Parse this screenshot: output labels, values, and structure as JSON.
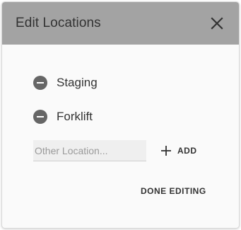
{
  "dialog": {
    "title": "Edit Locations",
    "close_icon": "close-icon",
    "header_color": "#a3a3a3"
  },
  "locations": [
    {
      "label": "Staging",
      "remove_icon": "minus-circle-icon"
    },
    {
      "label": "Forklift",
      "remove_icon": "minus-circle-icon"
    }
  ],
  "new_location": {
    "placeholder": "Other Location...",
    "value": ""
  },
  "add_button": {
    "label": "ADD",
    "icon": "plus-icon"
  },
  "done_button": {
    "label": "DONE EDITING"
  }
}
